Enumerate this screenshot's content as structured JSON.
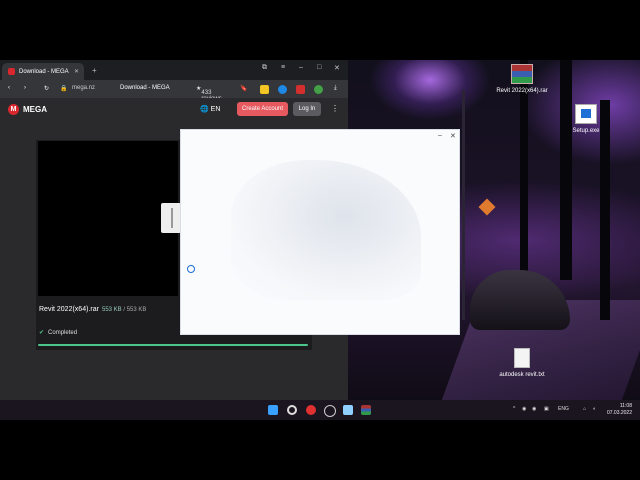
{
  "browser": {
    "tab_title": "Download - MEGA",
    "address": "mega.nz",
    "page_title": "Download - MEGA",
    "reviews": "433 reviews"
  },
  "mega": {
    "logo_letter": "M",
    "logo_text": "MEGA",
    "language": "EN",
    "create_account": "Create Account",
    "login": "Log In",
    "file_name": "Revit 2022(x64).rar",
    "downloaded": "553 KB",
    "total": "553 KB",
    "status": "Completed",
    "progress": 1.0
  },
  "desktop": {
    "icons": [
      {
        "name": "winrar-file",
        "label": "Revit 2022(x64).rar"
      },
      {
        "name": "setup-exe",
        "label": "Setup.exe"
      },
      {
        "name": "autodesk-txt",
        "label": "autodesk revit.txt"
      }
    ]
  },
  "taskbar": {
    "language": "ENG",
    "time": "11:08",
    "date": "07.03.2022"
  }
}
